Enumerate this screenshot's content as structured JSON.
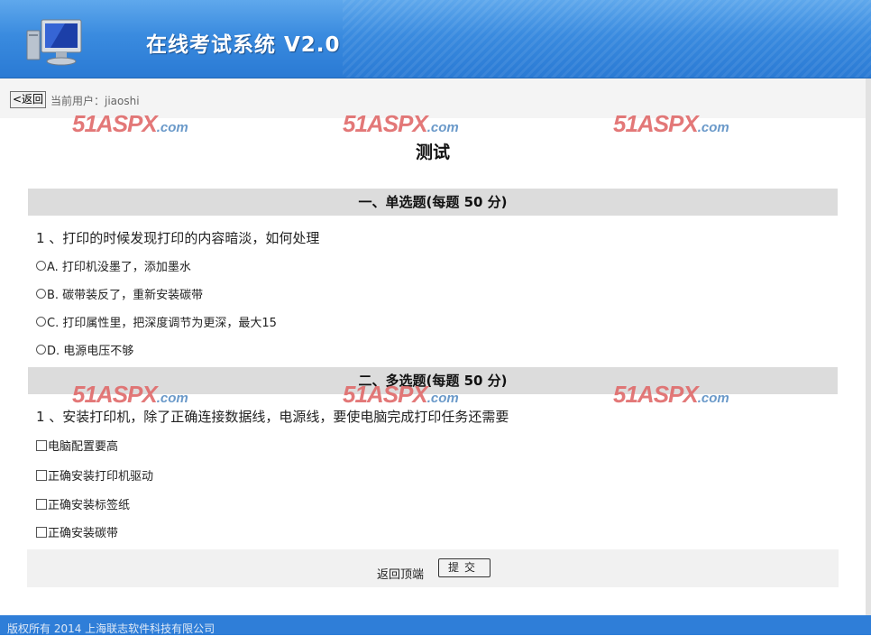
{
  "header": {
    "title": "在线考试系统 V2.0"
  },
  "toolbar": {
    "back_label": "<返回",
    "current_user": "当前用户：jiaoshi"
  },
  "watermark": {
    "main": "51ASPX",
    "suffix": ".com"
  },
  "exam": {
    "title": "测试"
  },
  "sections": [
    {
      "heading": "一、单选题(每题 50 分)",
      "question": "1 、打印的时候发现打印的内容暗淡，如何处理",
      "options": [
        "A. 打印机没墨了，添加墨水",
        "B. 碳带装反了，重新安装碳带",
        "C. 打印属性里，把深度调节为更深，最大15",
        "D. 电源电压不够"
      ]
    },
    {
      "heading": "二、多选题(每题 50 分)",
      "question": "1 、安装打印机，除了正确连接数据线，电源线，要使电脑完成打印任务还需要",
      "options": [
        "电脑配置要高",
        "正确安装打印机驱动",
        "正确安装标签纸",
        "正确安装碳带"
      ]
    }
  ],
  "actions": {
    "back_top": "返回顶端",
    "submit": "提交"
  },
  "footer": {
    "copyright": "版权所有 2014 上海联志软件科技有限公司"
  },
  "colors": {
    "header_blue": "#3a8bdf",
    "section_gray": "#dcdcdc",
    "watermark_red": "#e06a6a"
  }
}
